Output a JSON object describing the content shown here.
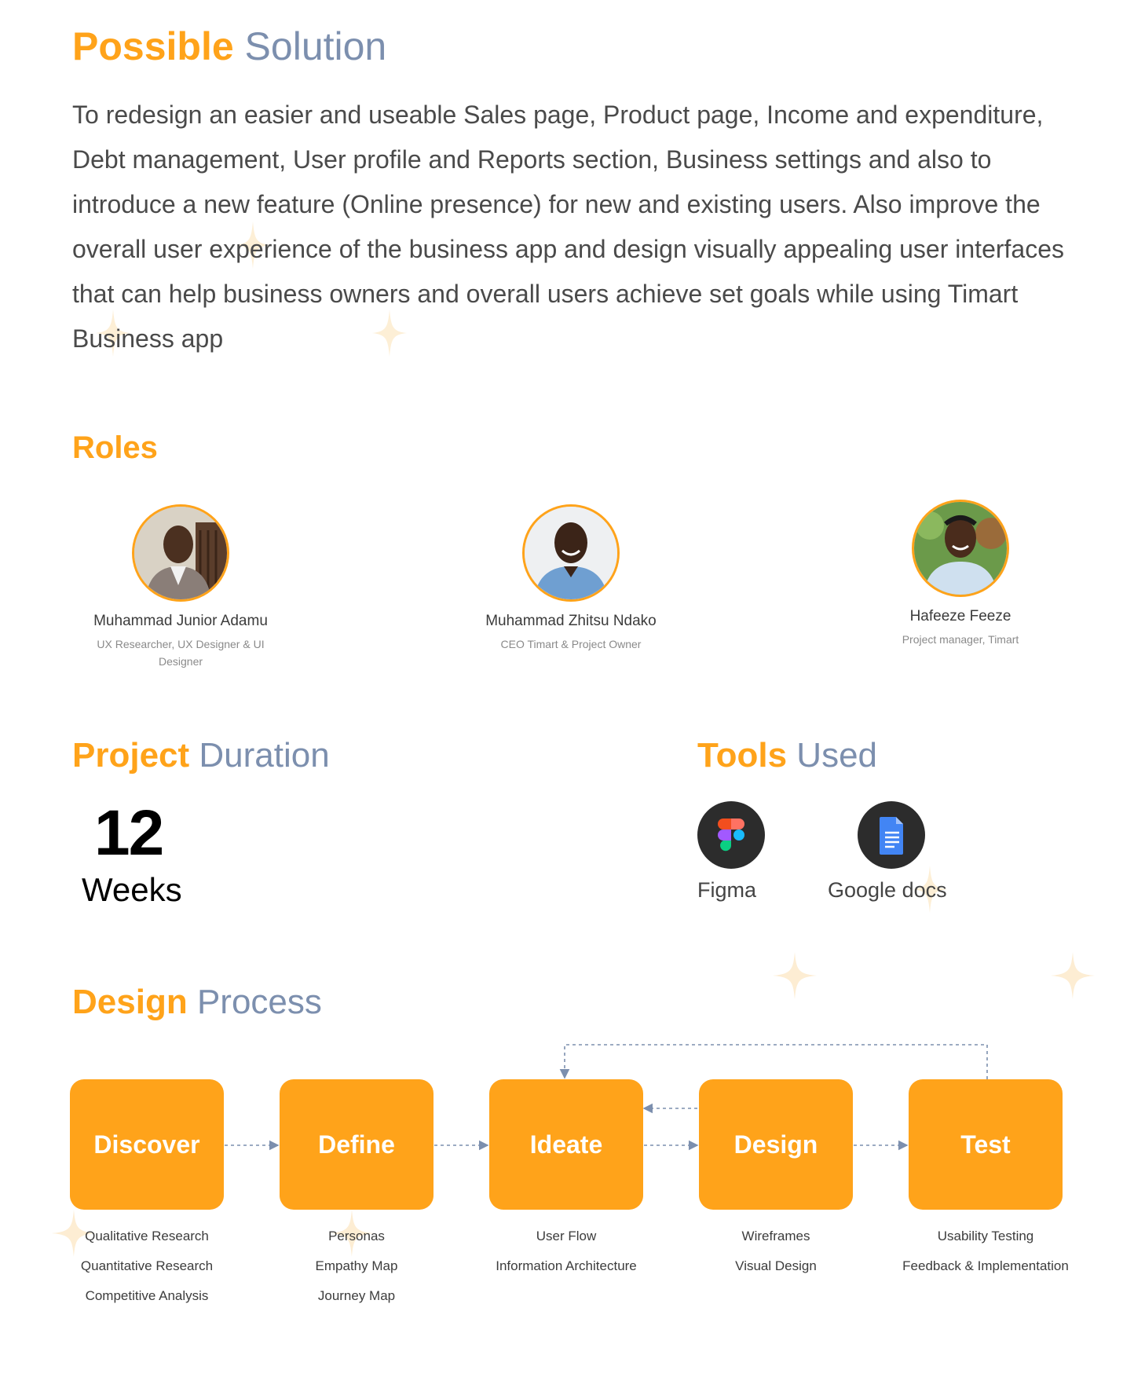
{
  "solution": {
    "title_bold": "Possible",
    "title_thin": "Solution",
    "paragraph": "To redesign an easier and useable Sales page, Product page, Income and expenditure, Debt management, User profile and Reports section, Business settings and also to introduce a new feature (Online presence) for new and existing users. Also improve the overall user experience of the business app and design visually appealing user interfaces that can help business owners and overall users achieve set goals while using Timart Business app"
  },
  "roles": {
    "title": "Roles",
    "people": [
      {
        "name": "Muhammad Junior Adamu",
        "title": "UX Researcher, UX Designer & UI Designer"
      },
      {
        "name": "Muhammad Zhitsu Ndako",
        "title": "CEO Timart & Project Owner"
      },
      {
        "name": "Hafeeze Feeze",
        "title": "Project manager, Timart"
      }
    ]
  },
  "duration": {
    "title_bold": "Project",
    "title_thin": "Duration",
    "number": "12",
    "unit": "Weeks"
  },
  "tools": {
    "title_bold": "Tools",
    "title_thin": "Used",
    "items": [
      {
        "label": "Figma",
        "icon": "figma-icon"
      },
      {
        "label": "Google docs",
        "icon": "google-docs-icon"
      }
    ]
  },
  "process": {
    "title_bold": "Design",
    "title_thin": "Process",
    "steps": [
      {
        "label": "Discover",
        "items": [
          "Qualitative Research",
          "Quantitative Research",
          "Competitive Analysis"
        ]
      },
      {
        "label": "Define",
        "items": [
          "Personas",
          "Empathy Map",
          "Journey Map"
        ]
      },
      {
        "label": "Ideate",
        "items": [
          "User Flow",
          "Information Architecture"
        ]
      },
      {
        "label": "Design",
        "items": [
          "Wireframes",
          "Visual Design"
        ]
      },
      {
        "label": "Test",
        "items": [
          "Usability Testing",
          "Feedback & Implementation"
        ]
      }
    ]
  },
  "colors": {
    "accent": "#FFA31A",
    "muted": "#7C8FAE",
    "connector": "#7C8FAE"
  }
}
